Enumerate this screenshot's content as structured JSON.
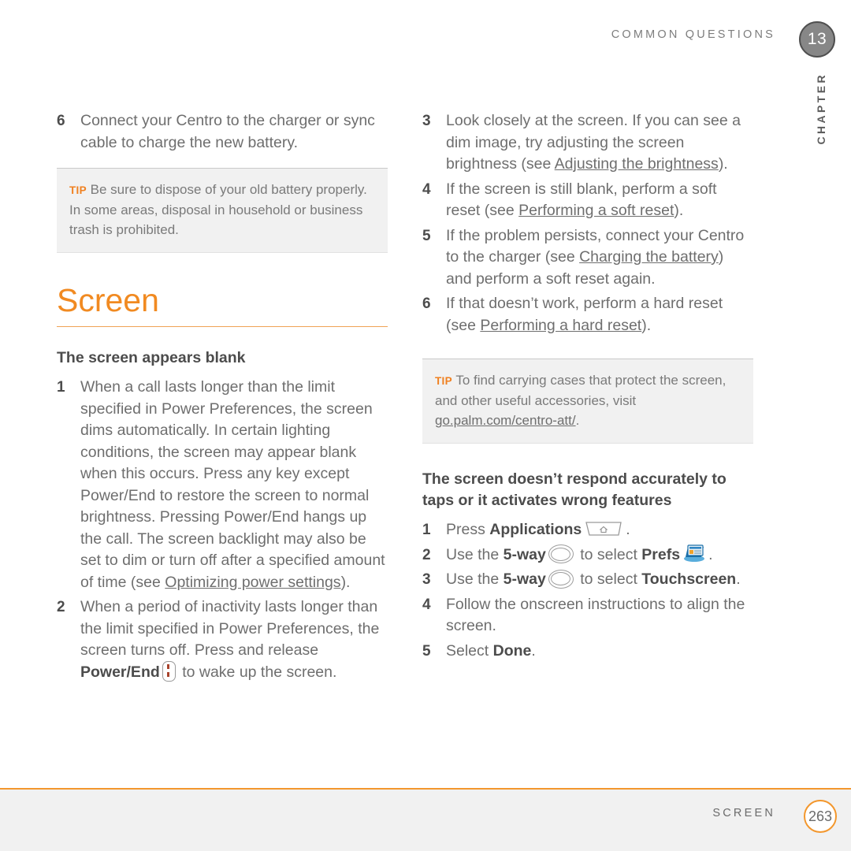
{
  "header": {
    "title": "COMMON QUESTIONS",
    "chapter_number": "13",
    "chapter_label": "CHAPTER"
  },
  "colors": {
    "accent_orange": "#f18a21",
    "rule_orange": "#f3972d",
    "body_gray": "#6e6e6e",
    "bold_gray": "#4c4c4c",
    "tip_background": "#f1f1f1",
    "badge_gray": "#878787"
  },
  "left_column": {
    "continued_step": {
      "number": "6",
      "text": "Connect your Centro to the charger or sync cable to charge the new battery."
    },
    "tip": {
      "label": "TIP",
      "text": "Be sure to dispose of your old battery properly. In some areas, disposal in household or business trash is prohibited."
    },
    "section_heading": "Screen",
    "subheading": "The screen appears blank",
    "steps": [
      {
        "number": "1",
        "part1": "When a call lasts longer than the limit specified in Power Preferences, the screen dims automatically. In certain lighting conditions, the screen may appear blank when this occurs. Press any key except Power/End to restore the screen to normal brightness. Pressing Power/End hangs up the call. The screen backlight may also be set to dim or turn off after a specified amount of time (see ",
        "link": "Optimizing power settings",
        "part2": ")."
      },
      {
        "number": "2",
        "part1": "When a period of inactivity lasts longer than the limit specified in Power Preferences, the screen turns off. Press and release ",
        "bold": "Power/End",
        "icon": "power-end-key-icon",
        "part2": " to wake up the screen."
      }
    ]
  },
  "right_column": {
    "steps_top": [
      {
        "number": "3",
        "part1": "Look closely at the screen. If you can see a dim image, try adjusting the screen brightness (see ",
        "link": "Adjusting the brightness",
        "part2": ")."
      },
      {
        "number": "4",
        "part1": "If the screen is still blank, perform a soft reset (see ",
        "link": "Performing a soft reset",
        "part2": ")."
      },
      {
        "number": "5",
        "part1": "If the problem persists, connect your Centro to the charger (see ",
        "link": "Charging the battery",
        "part2": ") and perform a soft reset again."
      },
      {
        "number": "6",
        "part1": "If that doesn’t work, perform a hard reset (see ",
        "link": "Performing a hard reset",
        "part2": ")."
      }
    ],
    "tip": {
      "label": "TIP",
      "part1": "To find carrying cases that protect the screen, and other useful accessories, visit ",
      "link": "go.palm.com/centro-att/",
      "part2": "."
    },
    "subheading": "The screen doesn’t respond accurately to taps or it activates wrong features",
    "steps_bottom": [
      {
        "number": "1",
        "part1": "Press ",
        "bold": "Applications",
        "icon": "applications-key-icon",
        "part2": "."
      },
      {
        "number": "2",
        "part1": "Use the ",
        "bold": "5-way",
        "icon": "five-way-nav-icon",
        "part2": " to select ",
        "bold2": "Prefs",
        "icon2": "prefs-app-icon",
        "part3": "."
      },
      {
        "number": "3",
        "part1": "Use the ",
        "bold": "5-way",
        "icon": "five-way-nav-icon",
        "part2": " to select ",
        "bold2": "Touchscreen",
        "part3": "."
      },
      {
        "number": "4",
        "part1": "Follow the onscreen instructions to align the screen."
      },
      {
        "number": "5",
        "part1": "Select ",
        "bold": "Done",
        "part2": "."
      }
    ]
  },
  "footer": {
    "title": "SCREEN",
    "page_number": "263"
  }
}
